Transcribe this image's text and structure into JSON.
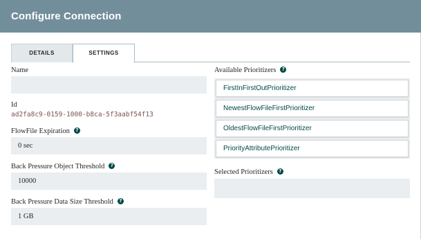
{
  "dialog": {
    "title": "Configure Connection"
  },
  "tabs": [
    {
      "label": "DETAILS",
      "active": false
    },
    {
      "label": "SETTINGS",
      "active": true
    }
  ],
  "settings": {
    "name": {
      "label": "Name",
      "value": ""
    },
    "id": {
      "label": "Id",
      "value": "ad2fa8c9-0159-1000-b8ca-5f3aabf54f13"
    },
    "flowfile_expiration": {
      "label": "FlowFile Expiration",
      "value": "0 sec"
    },
    "back_pressure_object_threshold": {
      "label": "Back Pressure Object Threshold",
      "value": "10000"
    },
    "back_pressure_data_size_threshold": {
      "label": "Back Pressure Data Size Threshold",
      "value": "1 GB"
    }
  },
  "prioritizers": {
    "available_label": "Available Prioritizers",
    "available": [
      "FirstInFirstOutPrioritizer",
      "NewestFlowFileFirstPrioritizer",
      "OldestFlowFileFirstPrioritizer",
      "PriorityAttributePrioritizer"
    ],
    "selected_label": "Selected Prioritizers",
    "selected": []
  },
  "icons": {
    "help": "question-circle-icon"
  },
  "colors": {
    "titlebar": "#728e9b",
    "field_bg": "#eaeef0",
    "id_text": "#775351",
    "prioritizer_text": "#004849",
    "help_icon": "#004849"
  }
}
